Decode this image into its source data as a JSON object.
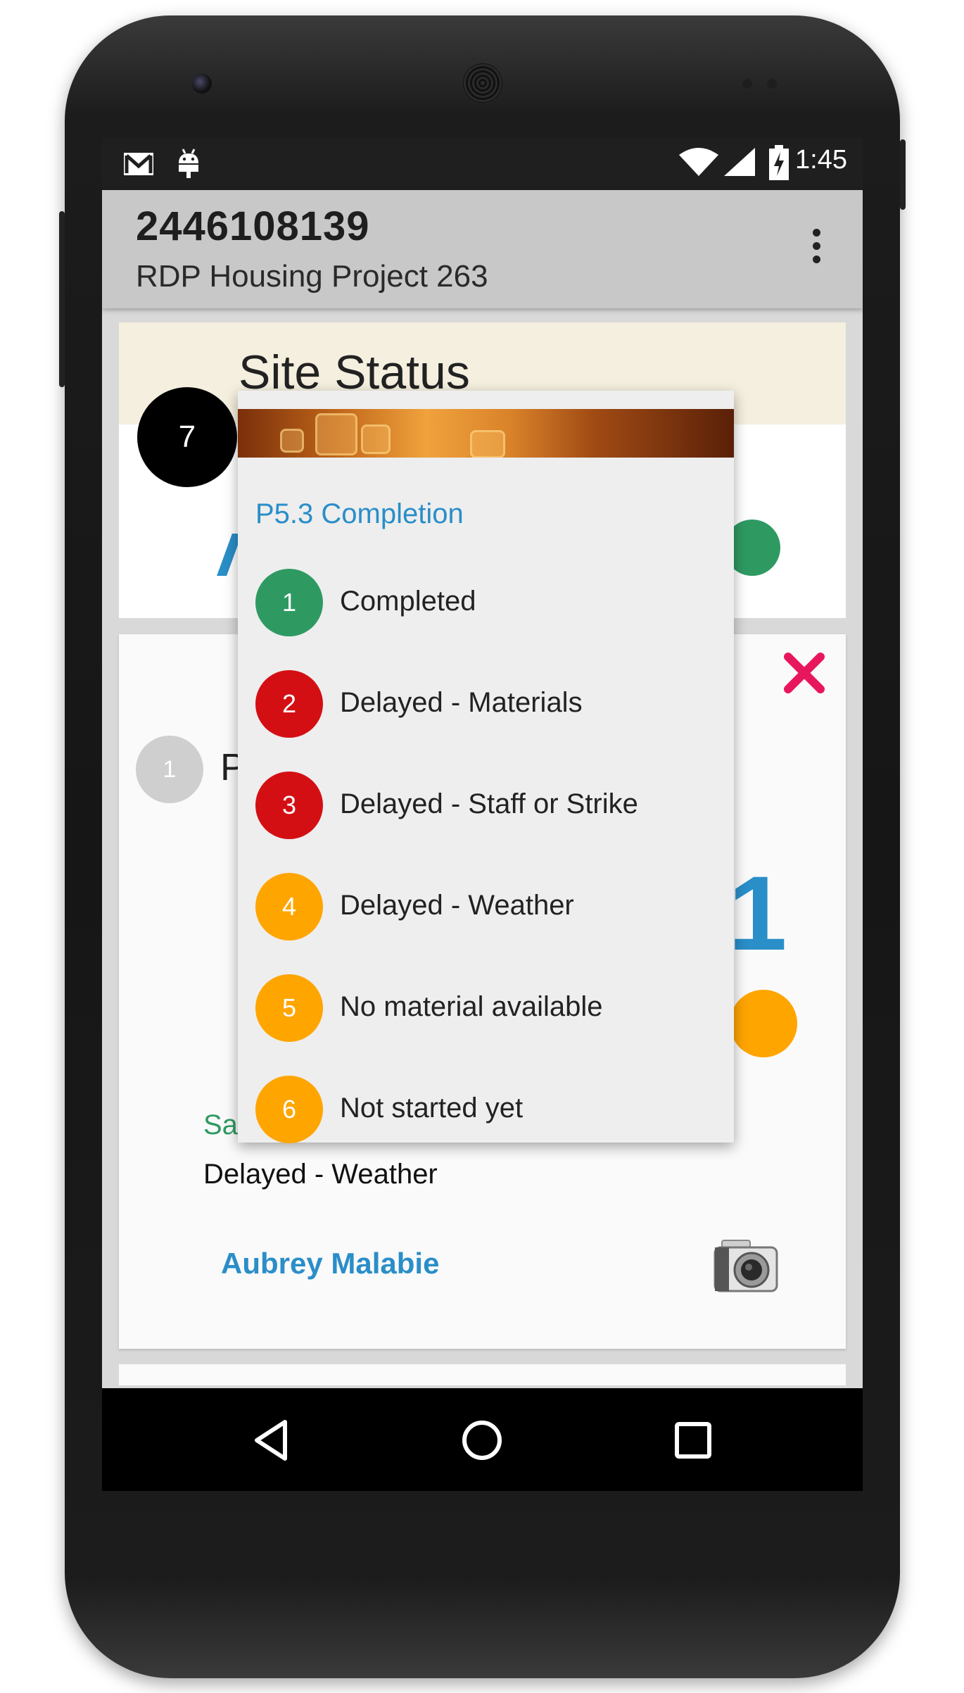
{
  "status_bar": {
    "time": "1:45",
    "icons": [
      "gmail-icon",
      "android-debug-icon",
      "wifi-icon",
      "cell-signal-icon",
      "battery-charging-icon"
    ]
  },
  "app_bar": {
    "title": "2446108139",
    "subtitle": "RDP Housing Project 263",
    "menu_icon": "overflow-menu-icon"
  },
  "site_card": {
    "title": "Site Status",
    "badge": "7"
  },
  "detail_card": {
    "badge": "1",
    "heading_partial": "P",
    "big_value": "1",
    "status_label_partial": "Sa",
    "status_value": "Delayed - Weather",
    "person": "Aubrey Malabie",
    "close_icon": "close-icon",
    "camera_icon": "camera-icon"
  },
  "popup": {
    "title": "P5.3 Completion",
    "options": [
      {
        "num": "1",
        "label": "Completed",
        "color": "#2e9a62"
      },
      {
        "num": "2",
        "label": "Delayed - Materials",
        "color": "#d40f14"
      },
      {
        "num": "3",
        "label": "Delayed - Staff or Strike",
        "color": "#d40f14"
      },
      {
        "num": "4",
        "label": "Delayed - Weather",
        "color": "#ffa500"
      },
      {
        "num": "5",
        "label": "No material available",
        "color": "#ffa500"
      },
      {
        "num": "6",
        "label": "Not started yet",
        "color": "#ffa500"
      }
    ]
  },
  "nav_bar": {
    "icons": [
      "back-icon",
      "home-icon",
      "recents-icon"
    ]
  },
  "colors": {
    "accent_blue": "#2a8ec8",
    "green": "#2e9a62",
    "red": "#d40f14",
    "orange": "#ffa500",
    "close_pink": "#e8175d"
  }
}
